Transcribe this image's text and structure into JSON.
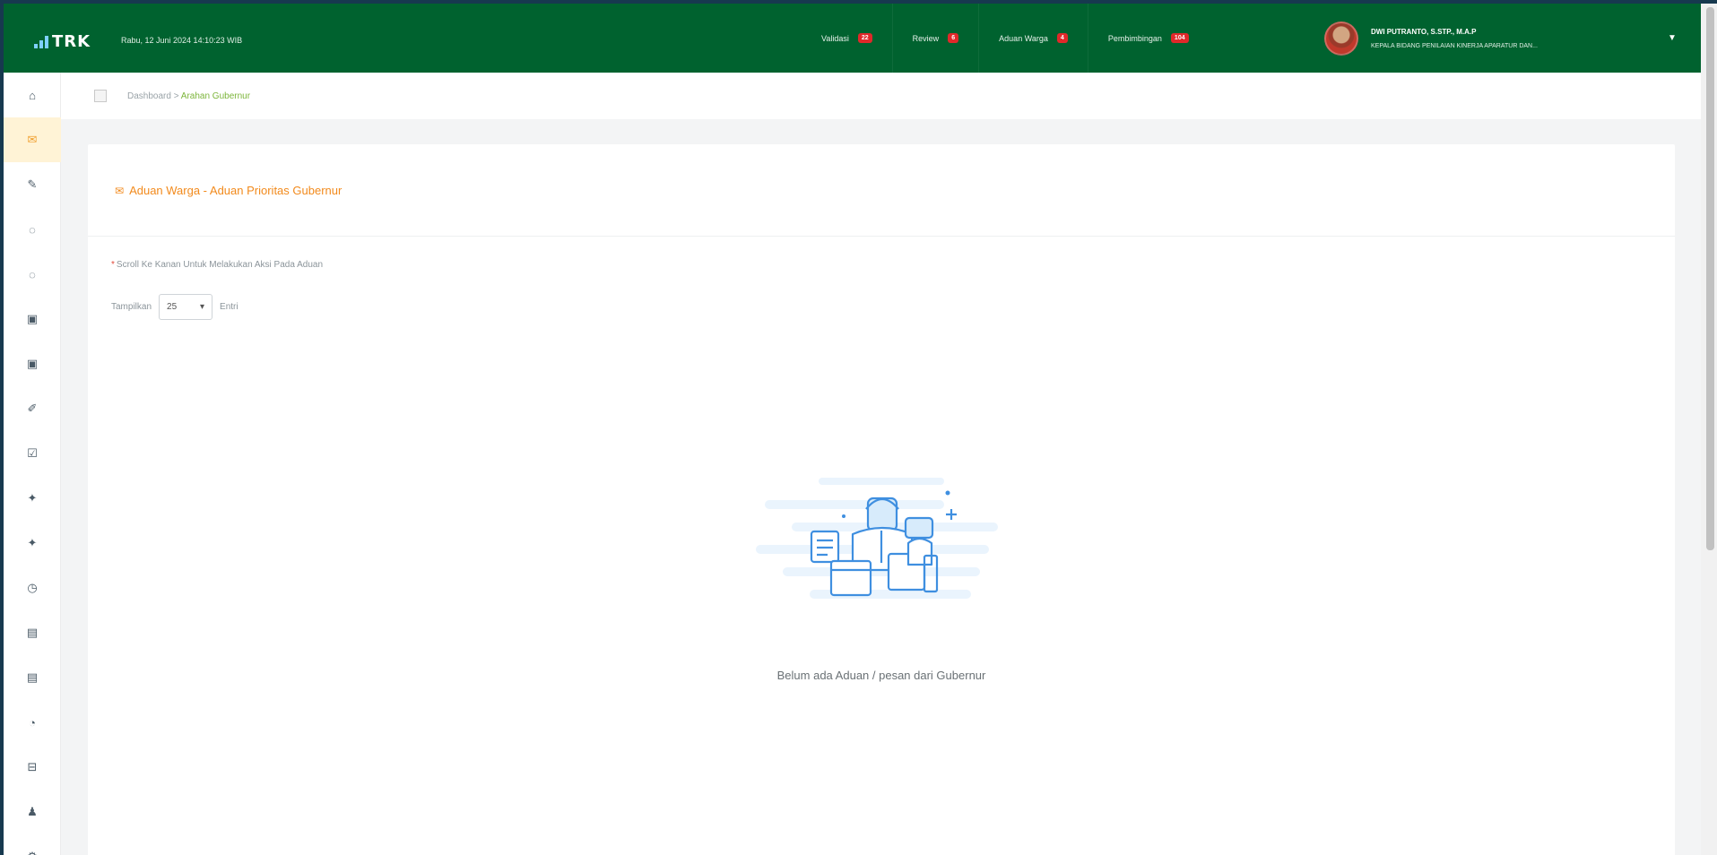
{
  "header": {
    "logo_text": "TRK",
    "datetime": "Rabu, 12 Juni 2024 14:10:23 WIB",
    "nav": [
      {
        "label": "Validasi",
        "badge": "22"
      },
      {
        "label": "Review",
        "badge": "6"
      },
      {
        "label": "Aduan Warga",
        "badge": "4"
      },
      {
        "label": "Pembimbingan",
        "badge": "104"
      }
    ],
    "user": {
      "name": "DWI PUTRANTO, S.STP., M.A.P",
      "role": "KEPALA BIDANG PENILAIAN KINERJA APARATUR DAN..."
    }
  },
  "breadcrumb": {
    "home": "Dashboard",
    "separator": ">",
    "current": "Arahan Gubernur"
  },
  "card": {
    "title": "Aduan Warga - Aduan Prioritas Gubernur",
    "note": "Scroll Ke Kanan Untuk Melakukan Aksi Pada Aduan",
    "show_label": "Tampilkan",
    "show_value": "25",
    "show_suffix": "Entri",
    "empty_text": "Belum ada Aduan / pesan dari Gubernur"
  },
  "sidebar_icons": [
    "home-icon",
    "complaint-icon",
    "edit-icon",
    "chat-icon",
    "chat-icon",
    "doc-icon",
    "doc-icon",
    "pencil-icon",
    "edit-icon",
    "star-icon",
    "star-icon",
    "clock-icon",
    "report-icon",
    "report-icon",
    "chart-icon",
    "folder-icon",
    "user-icon",
    "settings-icon"
  ],
  "colors": {
    "topbar": "#00622f",
    "accent": "#f28a1c",
    "badge": "#e0282a",
    "breadcrumb_current": "#7cb53a"
  }
}
